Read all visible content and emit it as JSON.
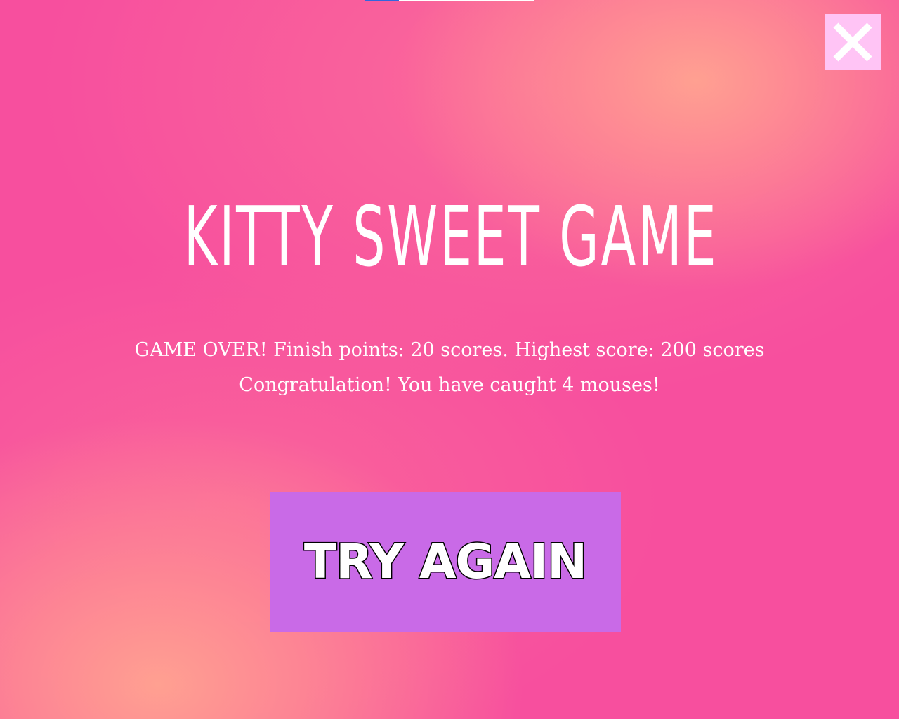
{
  "top_bar": {
    "progress": 0.2,
    "color": "#3366dd"
  },
  "close_button": {
    "icon": "close-icon",
    "color": "#ffc4f5"
  },
  "title": "KITTY SWEET GAME",
  "result": {
    "line1": "GAME OVER! Finish points: 20 scores.  Highest score: 200 scores",
    "line2": "Congratulation! You have caught 4 mouses!"
  },
  "try_again_label": "TRY AGAIN",
  "colors": {
    "background": "#f74f9e",
    "glow": "#ffa091",
    "button": "#c96ae7",
    "text": "#ffffff"
  }
}
